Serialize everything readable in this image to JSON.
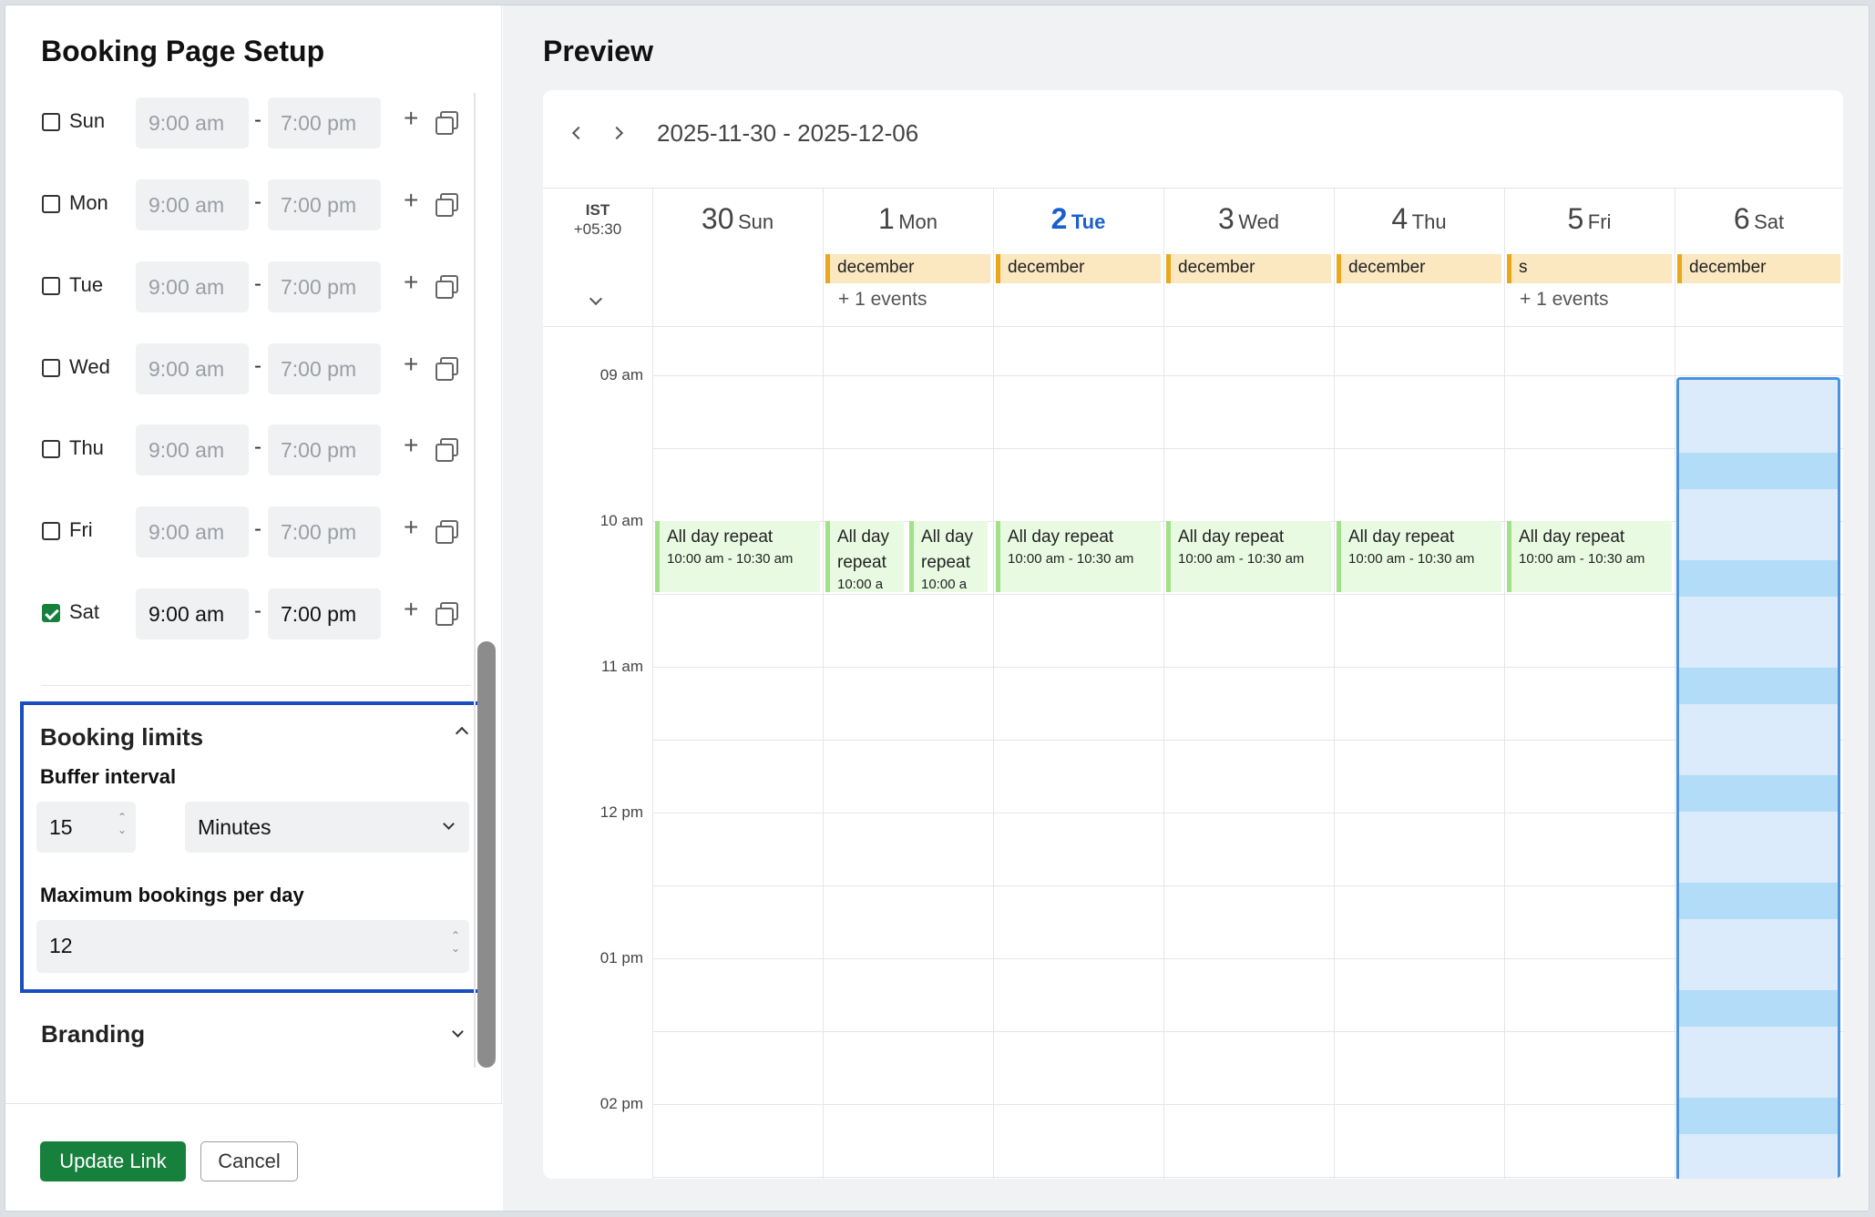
{
  "setup": {
    "title": "Booking Page Setup",
    "days": [
      {
        "label": "Sun",
        "checked": false,
        "start": "9:00 am",
        "end": "7:00 pm"
      },
      {
        "label": "Mon",
        "checked": false,
        "start": "9:00 am",
        "end": "7:00 pm"
      },
      {
        "label": "Tue",
        "checked": false,
        "start": "9:00 am",
        "end": "7:00 pm"
      },
      {
        "label": "Wed",
        "checked": false,
        "start": "9:00 am",
        "end": "7:00 pm"
      },
      {
        "label": "Thu",
        "checked": false,
        "start": "9:00 am",
        "end": "7:00 pm"
      },
      {
        "label": "Fri",
        "checked": false,
        "start": "9:00 am",
        "end": "7:00 pm"
      },
      {
        "label": "Sat",
        "checked": true,
        "start": "9:00 am",
        "end": "7:00 pm"
      }
    ],
    "separator": "-",
    "add_symbol": "+",
    "limits": {
      "title": "Booking limits",
      "buffer_label": "Buffer interval",
      "buffer_value": "15",
      "buffer_unit": "Minutes",
      "max_label": "Maximum bookings per day",
      "max_value": "12"
    },
    "branding_title": "Branding",
    "update_button": "Update Link",
    "cancel_button": "Cancel"
  },
  "preview": {
    "title": "Preview",
    "range": "2025-11-30 - 2025-12-06",
    "timezone_code": "IST",
    "timezone_offset": "+05:30",
    "days": [
      {
        "num": "30",
        "name": "Sun",
        "today": false,
        "allday": null,
        "more": ""
      },
      {
        "num": "1",
        "name": "Mon",
        "today": false,
        "allday": "december",
        "more": "+ 1 events"
      },
      {
        "num": "2",
        "name": "Tue",
        "today": true,
        "allday": "december",
        "more": ""
      },
      {
        "num": "3",
        "name": "Wed",
        "today": false,
        "allday": "december",
        "more": ""
      },
      {
        "num": "4",
        "name": "Thu",
        "today": false,
        "allday": "december",
        "more": ""
      },
      {
        "num": "5",
        "name": "Fri",
        "today": false,
        "allday": "s",
        "more": "+ 1 events"
      },
      {
        "num": "6",
        "name": "Sat",
        "today": false,
        "allday": "december",
        "more": ""
      }
    ],
    "time_labels": [
      "09 am",
      "10 am",
      "11 am",
      "12 pm",
      "01 pm",
      "02 pm"
    ],
    "event": {
      "title": "All day repeat",
      "time": "10:00 am - 10:30 am",
      "time_truncated": "10:00 a",
      "title_split": [
        "All day",
        "repeat"
      ]
    },
    "colors": {
      "accent": "#17803d",
      "today": "#1a5fcf",
      "highlight": "#1a4dbf",
      "event_bg": "#e8fbe2",
      "allday_bg": "#fbe7c0",
      "slot": "#b3dcf8"
    }
  }
}
